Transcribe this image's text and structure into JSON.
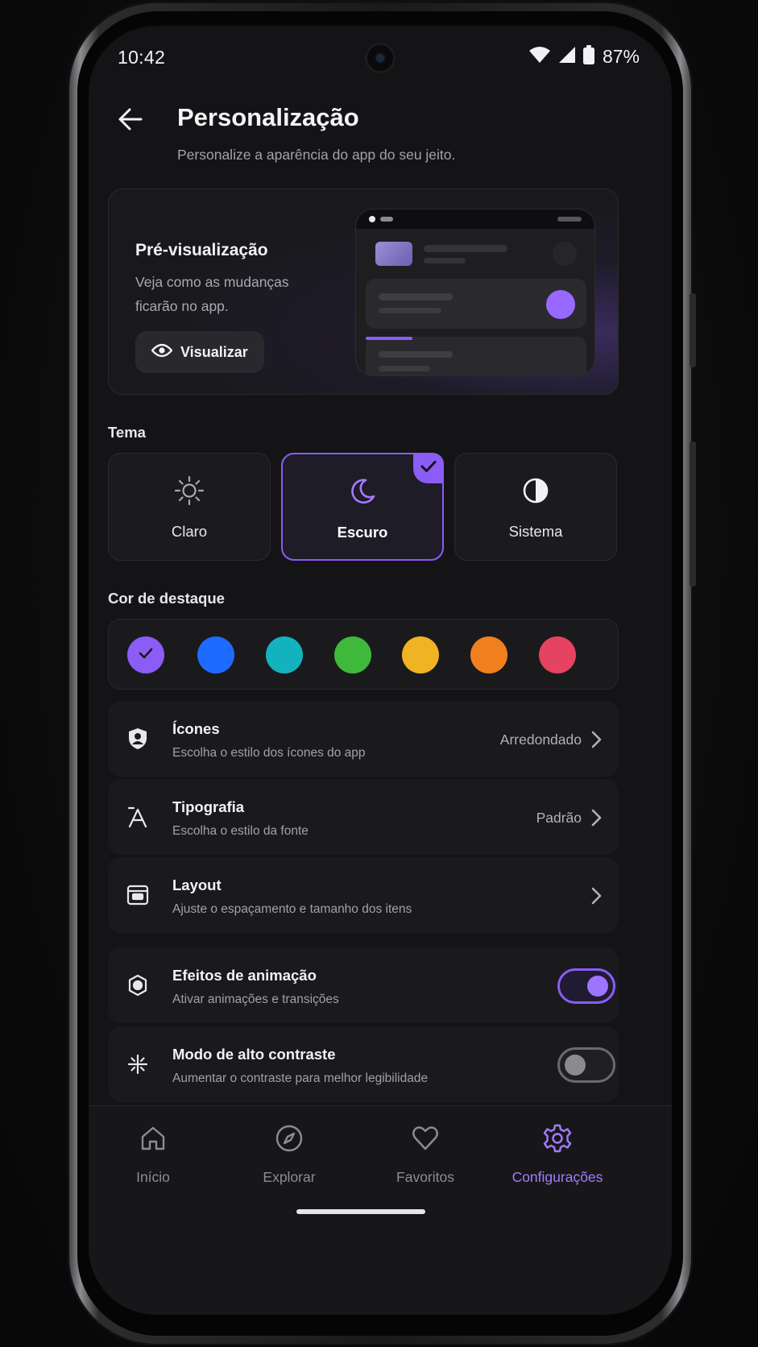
{
  "status_bar": {
    "time": "10:42",
    "battery": "87%"
  },
  "header": {
    "title": "Personalização",
    "subtitle": "Personalize a aparência do app do seu jeito."
  },
  "preview": {
    "title": "Pré-visualização",
    "description": "Veja como as mudanças ficarão no app.",
    "button_label": "Visualizar"
  },
  "theme": {
    "label": "Tema",
    "options": [
      {
        "label": "Claro",
        "icon": "sun-icon",
        "selected": false
      },
      {
        "label": "Escuro",
        "icon": "moon-icon",
        "selected": true
      },
      {
        "label": "Sistema",
        "icon": "half-circle-icon",
        "selected": false
      }
    ]
  },
  "accent": {
    "label": "Cor de destaque",
    "colors": [
      "#8b5cf6",
      "#1e6bff",
      "#12b3bf",
      "#3fb93c",
      "#f0b323",
      "#f0801e",
      "#e5435f"
    ],
    "selected_index": 0
  },
  "settings": [
    {
      "title": "Ícones",
      "subtitle": "Escolha o estilo dos ícones do app",
      "value": "Arredondado",
      "icon": "user-shield-icon"
    },
    {
      "title": "Tipografia",
      "subtitle": "Escolha o estilo da fonte",
      "value": "Padrão",
      "icon": "typography-icon"
    },
    {
      "title": "Layout",
      "subtitle": "Ajuste o espaçamento e tamanho dos itens",
      "value": "",
      "icon": "layout-icon"
    }
  ],
  "toggles": [
    {
      "title": "Efeitos de animação",
      "subtitle": "Ativar animações e transições",
      "on": true,
      "icon": "animation-icon"
    },
    {
      "title": "Modo de alto contraste",
      "subtitle": "Aumentar o contraste para melhor legibilidade",
      "on": false,
      "icon": "contrast-icon"
    }
  ],
  "nav": {
    "items": [
      {
        "label": "Início",
        "icon": "home-icon"
      },
      {
        "label": "Explorar",
        "icon": "compass-icon"
      },
      {
        "label": "Favoritos",
        "icon": "heart-icon"
      },
      {
        "label": "Configurações",
        "icon": "gear-icon"
      }
    ],
    "active_index": 3
  },
  "colors": {
    "accent": "#8b5cf6",
    "background": "#141416",
    "card": "#1a1a1d"
  }
}
